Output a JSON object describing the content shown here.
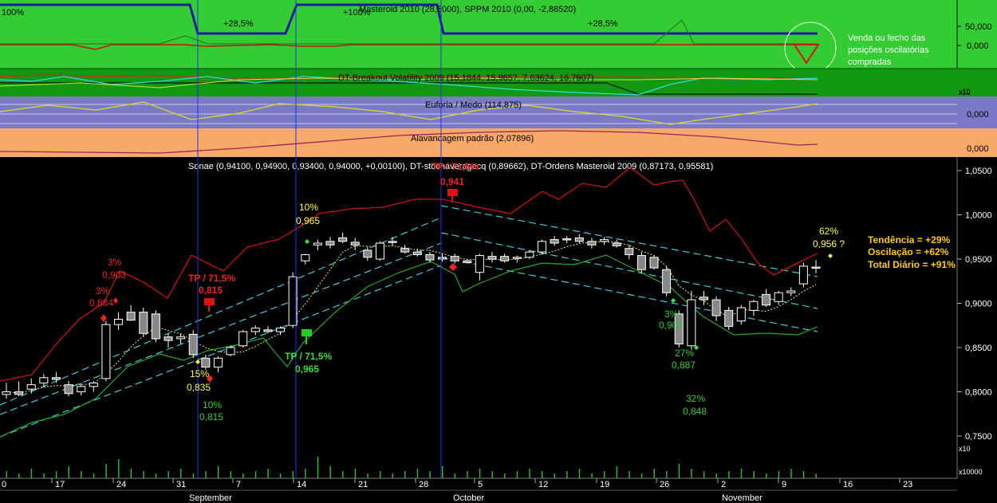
{
  "panels": {
    "masteroid": {
      "title": "Masteroid 2010 (28,5000), SPPM 2010 (0,00, -2,88520)",
      "pct_left": "100%",
      "pct_mid": "+100%",
      "pct_a": "+28,5%",
      "pct_b": "+28,5%",
      "axis": [
        "50,000",
        "0,000"
      ],
      "note": [
        "Venda ou fecho das",
        "posições oscilatórias",
        "compradas"
      ]
    },
    "breakout": {
      "title": "DT-Breakout Volatility 2009 (15,1844, 15,9657, 7,63624, 16,7907)",
      "scale": "x10"
    },
    "euforia": {
      "title": "Euforia / Medo (114,875)",
      "axis": [
        "0,000"
      ],
      "scale": "x10"
    },
    "alavancagem": {
      "title": "Alavancagem padrão (2,07896)",
      "axis": [
        "0,000"
      ]
    },
    "main": {
      "title": "Sonae (0,94100, 0,94900, 0,93400, 0,94000, +0,00100), DT-stochaveragecq (0,89662), DT-Ordens Masteroid 2009 (0,87173, 0,95581)",
      "volume_scale": "x10",
      "volume_unit": "x10000"
    }
  },
  "chart_data": {
    "type": "candlestick",
    "y_axis": {
      "ticks": [
        "1,0500",
        "1,0000",
        "0,9500",
        "0,9000",
        "0,8500",
        "0,8000",
        "0,7500"
      ],
      "ylim": [
        0.72,
        1.06
      ]
    },
    "x_axis": {
      "day_ticks": [
        "0",
        "17",
        "24",
        "31",
        "7",
        "14",
        "21",
        "28",
        "5",
        "12",
        "19",
        "26",
        "2",
        "9",
        "16",
        "23"
      ],
      "months": [
        "September",
        "October",
        "November"
      ]
    },
    "candles": [
      {
        "o": 0.797,
        "h": 0.81,
        "l": 0.792,
        "c": 0.8
      },
      {
        "o": 0.8,
        "h": 0.812,
        "l": 0.795,
        "c": 0.797
      },
      {
        "o": 0.803,
        "h": 0.815,
        "l": 0.798,
        "c": 0.808
      },
      {
        "o": 0.81,
        "h": 0.82,
        "l": 0.806,
        "c": 0.816
      },
      {
        "o": 0.816,
        "h": 0.822,
        "l": 0.81,
        "c": 0.814
      },
      {
        "o": 0.808,
        "h": 0.812,
        "l": 0.795,
        "c": 0.798
      },
      {
        "o": 0.8,
        "h": 0.81,
        "l": 0.796,
        "c": 0.806
      },
      {
        "o": 0.806,
        "h": 0.812,
        "l": 0.8,
        "c": 0.81
      },
      {
        "o": 0.815,
        "h": 0.88,
        "l": 0.812,
        "c": 0.876
      },
      {
        "o": 0.876,
        "h": 0.89,
        "l": 0.87,
        "c": 0.882
      },
      {
        "o": 0.89,
        "h": 0.898,
        "l": 0.88,
        "c": 0.881
      },
      {
        "o": 0.89,
        "h": 0.895,
        "l": 0.862,
        "c": 0.866
      },
      {
        "o": 0.888,
        "h": 0.892,
        "l": 0.856,
        "c": 0.86
      },
      {
        "o": 0.862,
        "h": 0.866,
        "l": 0.85,
        "c": 0.858
      },
      {
        "o": 0.86,
        "h": 0.866,
        "l": 0.854,
        "c": 0.862
      },
      {
        "o": 0.865,
        "h": 0.87,
        "l": 0.838,
        "c": 0.842
      },
      {
        "o": 0.838,
        "h": 0.842,
        "l": 0.825,
        "c": 0.828
      },
      {
        "o": 0.828,
        "h": 0.84,
        "l": 0.822,
        "c": 0.838
      },
      {
        "o": 0.842,
        "h": 0.852,
        "l": 0.84,
        "c": 0.85
      },
      {
        "o": 0.852,
        "h": 0.87,
        "l": 0.85,
        "c": 0.868
      },
      {
        "o": 0.868,
        "h": 0.875,
        "l": 0.864,
        "c": 0.872
      },
      {
        "o": 0.87,
        "h": 0.874,
        "l": 0.866,
        "c": 0.868
      },
      {
        "o": 0.868,
        "h": 0.874,
        "l": 0.864,
        "c": 0.872
      },
      {
        "o": 0.875,
        "h": 0.935,
        "l": 0.872,
        "c": 0.93
      },
      {
        "o": 0.948,
        "h": 0.956,
        "l": 0.944,
        "c": 0.955
      },
      {
        "o": 0.966,
        "h": 0.972,
        "l": 0.96,
        "c": 0.968
      },
      {
        "o": 0.97,
        "h": 0.975,
        "l": 0.962,
        "c": 0.966
      },
      {
        "o": 0.974,
        "h": 0.98,
        "l": 0.968,
        "c": 0.97
      },
      {
        "o": 0.969,
        "h": 0.974,
        "l": 0.96,
        "c": 0.966
      },
      {
        "o": 0.96,
        "h": 0.964,
        "l": 0.948,
        "c": 0.952
      },
      {
        "o": 0.95,
        "h": 0.97,
        "l": 0.948,
        "c": 0.968
      },
      {
        "o": 0.97,
        "h": 0.975,
        "l": 0.965,
        "c": 0.969
      },
      {
        "o": 0.962,
        "h": 0.966,
        "l": 0.956,
        "c": 0.958
      },
      {
        "o": 0.958,
        "h": 0.962,
        "l": 0.953,
        "c": 0.955
      },
      {
        "o": 0.955,
        "h": 0.958,
        "l": 0.946,
        "c": 0.949
      },
      {
        "o": 0.952,
        "h": 0.956,
        "l": 0.947,
        "c": 0.95
      },
      {
        "o": 0.953,
        "h": 0.956,
        "l": 0.945,
        "c": 0.948
      },
      {
        "o": 0.948,
        "h": 0.95,
        "l": 0.945,
        "c": 0.946
      },
      {
        "o": 0.935,
        "h": 0.956,
        "l": 0.926,
        "c": 0.954
      },
      {
        "o": 0.953,
        "h": 0.958,
        "l": 0.946,
        "c": 0.95
      },
      {
        "o": 0.953,
        "h": 0.956,
        "l": 0.946,
        "c": 0.948
      },
      {
        "o": 0.951,
        "h": 0.954,
        "l": 0.946,
        "c": 0.952
      },
      {
        "o": 0.952,
        "h": 0.96,
        "l": 0.95,
        "c": 0.958
      },
      {
        "o": 0.958,
        "h": 0.972,
        "l": 0.955,
        "c": 0.97
      },
      {
        "o": 0.972,
        "h": 0.976,
        "l": 0.965,
        "c": 0.968
      },
      {
        "o": 0.973,
        "h": 0.976,
        "l": 0.968,
        "c": 0.972
      },
      {
        "o": 0.974,
        "h": 0.978,
        "l": 0.968,
        "c": 0.97
      },
      {
        "o": 0.97,
        "h": 0.974,
        "l": 0.962,
        "c": 0.966
      },
      {
        "o": 0.97,
        "h": 0.975,
        "l": 0.966,
        "c": 0.972
      },
      {
        "o": 0.968,
        "h": 0.972,
        "l": 0.963,
        "c": 0.965
      },
      {
        "o": 0.962,
        "h": 0.966,
        "l": 0.95,
        "c": 0.955
      },
      {
        "o": 0.954,
        "h": 0.958,
        "l": 0.934,
        "c": 0.938
      },
      {
        "o": 0.952,
        "h": 0.954,
        "l": 0.938,
        "c": 0.94
      },
      {
        "o": 0.938,
        "h": 0.942,
        "l": 0.908,
        "c": 0.912
      },
      {
        "o": 0.888,
        "h": 0.892,
        "l": 0.85,
        "c": 0.854
      },
      {
        "o": 0.852,
        "h": 0.914,
        "l": 0.848,
        "c": 0.904
      },
      {
        "o": 0.907,
        "h": 0.914,
        "l": 0.898,
        "c": 0.904
      },
      {
        "o": 0.904,
        "h": 0.908,
        "l": 0.88,
        "c": 0.886
      },
      {
        "o": 0.892,
        "h": 0.896,
        "l": 0.87,
        "c": 0.874
      },
      {
        "o": 0.88,
        "h": 0.898,
        "l": 0.876,
        "c": 0.895
      },
      {
        "o": 0.892,
        "h": 0.904,
        "l": 0.886,
        "c": 0.902
      },
      {
        "o": 0.91,
        "h": 0.916,
        "l": 0.896,
        "c": 0.898
      },
      {
        "o": 0.902,
        "h": 0.914,
        "l": 0.898,
        "c": 0.912
      },
      {
        "o": 0.912,
        "h": 0.918,
        "l": 0.908,
        "c": 0.914
      },
      {
        "o": 0.922,
        "h": 0.946,
        "l": 0.918,
        "c": 0.942
      },
      {
        "o": 0.941,
        "h": 0.949,
        "l": 0.934,
        "c": 0.94
      }
    ],
    "labels": [
      {
        "text": "3%",
        "value": "0,903",
        "color": "red"
      },
      {
        "text": "3%",
        "value": "0,884",
        "color": "red"
      },
      {
        "text": "TP / 71,5%",
        "value": "0,815",
        "color": "red"
      },
      {
        "text": "TP / 71,5%",
        "value": "0,941",
        "color": "red"
      },
      {
        "text": "10%",
        "value": "0,965",
        "color": "yellow"
      },
      {
        "text": "15%",
        "value": "0,835",
        "color": "yellow"
      },
      {
        "text": "10%",
        "value": "0,815",
        "color": "green"
      },
      {
        "text": "TP / 71,5%",
        "value": "0,965",
        "color": "green"
      },
      {
        "text": "3%",
        "value": "0,905",
        "color": "green"
      },
      {
        "text": "27%",
        "value": "0,887",
        "color": "green"
      },
      {
        "text": "32%",
        "value": "0,848",
        "color": "green"
      },
      {
        "text": "62%",
        "value": "0,956 ?",
        "color": "yellow"
      }
    ],
    "summary": [
      "Tendência = +29%",
      "Oscilação = +62%",
      "Total Diário = +91%"
    ]
  }
}
